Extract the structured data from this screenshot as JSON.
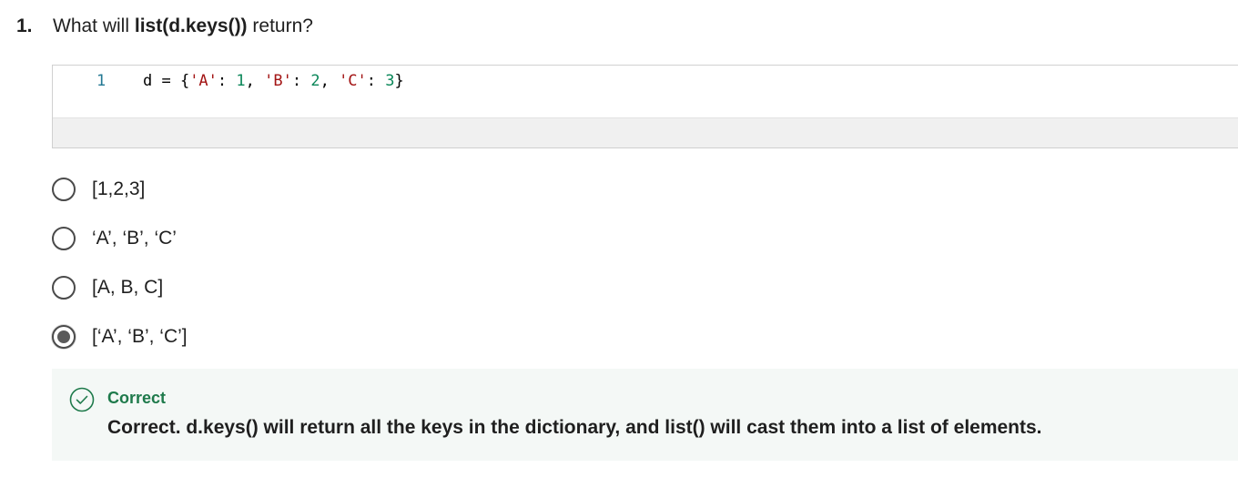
{
  "question": {
    "number": "1.",
    "prefix": "What will ",
    "emphasis": "list(d.keys())",
    "suffix": " return?"
  },
  "code": {
    "line_number": "1",
    "tokens": {
      "t1": "d = {",
      "t2": "'A'",
      "t3": ": ",
      "t4": "1",
      "t5": ", ",
      "t6": "'B'",
      "t7": ": ",
      "t8": "2",
      "t9": ", ",
      "t10": "'C'",
      "t11": ": ",
      "t12": "3",
      "t13": "}"
    }
  },
  "options": [
    {
      "label": "[1,2,3]",
      "selected": false
    },
    {
      "label": "‘A’, ‘B’, ‘C’",
      "selected": false
    },
    {
      "label": "[A, B, C]",
      "selected": false
    },
    {
      "label": "[‘A’, ‘B’, ‘C’]",
      "selected": true
    }
  ],
  "feedback": {
    "status": "Correct",
    "message": "Correct. d.keys() will return all the keys in the dictionary, and list() will cast them into a list of elements.",
    "icon": "check-circle-icon",
    "accent_color": "#1e7a4b"
  }
}
